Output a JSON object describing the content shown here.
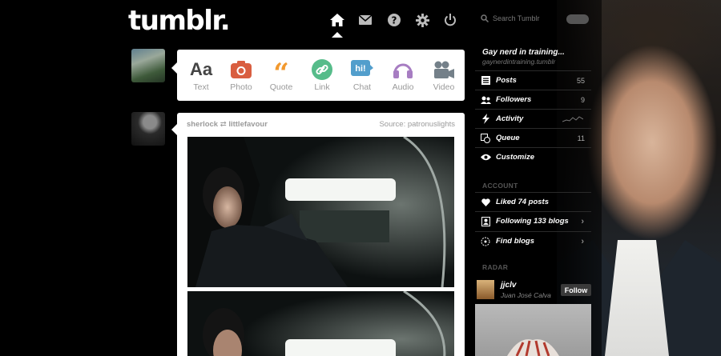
{
  "app": {
    "logo": "tumblr."
  },
  "nav": {
    "icons": [
      "home-icon",
      "mail-icon",
      "help-icon",
      "gear-icon",
      "power-icon"
    ]
  },
  "post_types": [
    {
      "label": "Text",
      "icon": "text-icon",
      "color": "#444444"
    },
    {
      "label": "Photo",
      "icon": "camera-icon",
      "color": "#d95e40"
    },
    {
      "label": "Quote",
      "icon": "quote-icon",
      "color": "#f2992e"
    },
    {
      "label": "Link",
      "icon": "link-icon",
      "color": "#56bc8a"
    },
    {
      "label": "Chat",
      "icon": "chat-icon",
      "color": "#529ecc"
    },
    {
      "label": "Audio",
      "icon": "headphones-icon",
      "color": "#a77dc2"
    },
    {
      "label": "Video",
      "icon": "video-icon",
      "color": "#748089"
    }
  ],
  "post": {
    "author": "sherlock",
    "reblogged_from": "littlefavour",
    "source": "Source: patronuslights"
  },
  "sidebar": {
    "search_placeholder": "Search Tumblr",
    "blog_title": "Gay nerd in training...",
    "blog_url": "gaynerdintraining.tumblr",
    "menu": [
      {
        "label": "Posts",
        "count": "55",
        "icon": "posts-icon"
      },
      {
        "label": "Followers",
        "count": "9",
        "icon": "followers-icon"
      },
      {
        "label": "Activity",
        "count": "",
        "icon": "activity-icon"
      },
      {
        "label": "Queue",
        "count": "11",
        "icon": "queue-icon"
      },
      {
        "label": "Customize",
        "count": "",
        "icon": "eye-icon"
      }
    ],
    "account_header": "ACCOUNT",
    "account": [
      {
        "label": "Liked 74 posts",
        "icon": "heart-icon"
      },
      {
        "label": "Following 133 blogs",
        "icon": "following-icon"
      },
      {
        "label": "Find blogs",
        "icon": "compass-icon"
      }
    ],
    "radar_header": "RADAR",
    "radar": {
      "name": "jjclv",
      "subtitle": "Juan José Calva",
      "follow_label": "Follow"
    }
  }
}
